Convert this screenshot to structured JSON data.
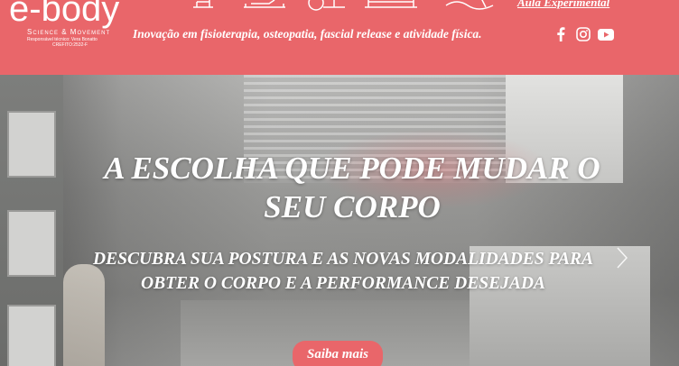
{
  "header": {
    "logo": {
      "word": "e-body",
      "subtitle": "Science & Movement",
      "responsible": "Responsável técnico: Vera Bonatto",
      "crefito": "CREFITO:2532-F"
    },
    "modality_icons": [
      "chair-exercise-icon",
      "reformer-icon",
      "barrel-icon",
      "cadillac-icon",
      "stretch-icon"
    ],
    "aula_link": "Aula Experimental",
    "tagline": "Inovação em fisioterapia, osteopatia, fascial release e atividade física.",
    "social": [
      "facebook-icon",
      "instagram-icon",
      "youtube-icon"
    ],
    "background_color": "#e9666a"
  },
  "hero": {
    "title": "A ESCOLHA QUE PODE MUDAR O SEU CORPO",
    "subtitle": "DESCUBRA SUA POSTURA E AS NOVAS MODALIDADES PARA OBTER O CORPO E A PERFORMANCE DESEJADA",
    "cta_label": "Saiba mais",
    "next_arrow": "chevron-right-icon",
    "accent_color": "#e9666a"
  }
}
